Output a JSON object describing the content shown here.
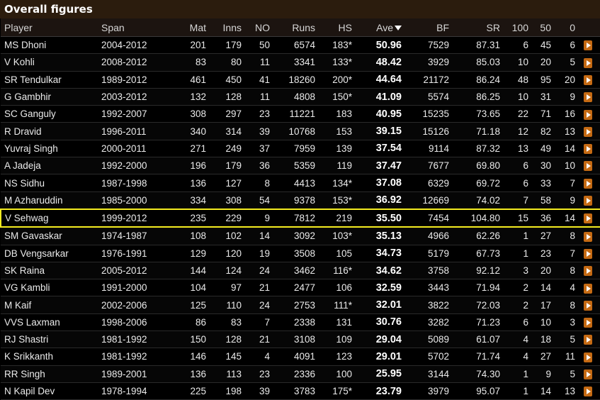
{
  "title": "Overall figures",
  "columns": {
    "player": "Player",
    "span": "Span",
    "mat": "Mat",
    "inns": "Inns",
    "no": "NO",
    "runs": "Runs",
    "hs": "HS",
    "ave": "Ave",
    "bf": "BF",
    "sr": "SR",
    "hundreds": "100",
    "fifties": "50",
    "ducks": "0"
  },
  "rows": [
    [
      "MS Dhoni",
      "2004-2012",
      "201",
      "179",
      "50",
      "6574",
      "183*",
      "50.96",
      "7529",
      "87.31",
      "6",
      "45",
      "6"
    ],
    [
      "V Kohli",
      "2008-2012",
      "83",
      "80",
      "11",
      "3341",
      "133*",
      "48.42",
      "3929",
      "85.03",
      "10",
      "20",
      "5"
    ],
    [
      "SR Tendulkar",
      "1989-2012",
      "461",
      "450",
      "41",
      "18260",
      "200*",
      "44.64",
      "21172",
      "86.24",
      "48",
      "95",
      "20"
    ],
    [
      "G Gambhir",
      "2003-2012",
      "132",
      "128",
      "11",
      "4808",
      "150*",
      "41.09",
      "5574",
      "86.25",
      "10",
      "31",
      "9"
    ],
    [
      "SC Ganguly",
      "1992-2007",
      "308",
      "297",
      "23",
      "11221",
      "183",
      "40.95",
      "15235",
      "73.65",
      "22",
      "71",
      "16"
    ],
    [
      "R Dravid",
      "1996-2011",
      "340",
      "314",
      "39",
      "10768",
      "153",
      "39.15",
      "15126",
      "71.18",
      "12",
      "82",
      "13"
    ],
    [
      "Yuvraj Singh",
      "2000-2011",
      "271",
      "249",
      "37",
      "7959",
      "139",
      "37.54",
      "9114",
      "87.32",
      "13",
      "49",
      "14"
    ],
    [
      "A Jadeja",
      "1992-2000",
      "196",
      "179",
      "36",
      "5359",
      "119",
      "37.47",
      "7677",
      "69.80",
      "6",
      "30",
      "10"
    ],
    [
      "NS Sidhu",
      "1987-1998",
      "136",
      "127",
      "8",
      "4413",
      "134*",
      "37.08",
      "6329",
      "69.72",
      "6",
      "33",
      "7"
    ],
    [
      "M Azharuddin",
      "1985-2000",
      "334",
      "308",
      "54",
      "9378",
      "153*",
      "36.92",
      "12669",
      "74.02",
      "7",
      "58",
      "9"
    ],
    [
      "V Sehwag",
      "1999-2012",
      "235",
      "229",
      "9",
      "7812",
      "219",
      "35.50",
      "7454",
      "104.80",
      "15",
      "36",
      "14"
    ],
    [
      "SM Gavaskar",
      "1974-1987",
      "108",
      "102",
      "14",
      "3092",
      "103*",
      "35.13",
      "4966",
      "62.26",
      "1",
      "27",
      "8"
    ],
    [
      "DB Vengsarkar",
      "1976-1991",
      "129",
      "120",
      "19",
      "3508",
      "105",
      "34.73",
      "5179",
      "67.73",
      "1",
      "23",
      "7"
    ],
    [
      "SK Raina",
      "2005-2012",
      "144",
      "124",
      "24",
      "3462",
      "116*",
      "34.62",
      "3758",
      "92.12",
      "3",
      "20",
      "8"
    ],
    [
      "VG Kambli",
      "1991-2000",
      "104",
      "97",
      "21",
      "2477",
      "106",
      "32.59",
      "3443",
      "71.94",
      "2",
      "14",
      "4"
    ],
    [
      "M Kaif",
      "2002-2006",
      "125",
      "110",
      "24",
      "2753",
      "111*",
      "32.01",
      "3822",
      "72.03",
      "2",
      "17",
      "8"
    ],
    [
      "VVS Laxman",
      "1998-2006",
      "86",
      "83",
      "7",
      "2338",
      "131",
      "30.76",
      "3282",
      "71.23",
      "6",
      "10",
      "3"
    ],
    [
      "RJ Shastri",
      "1981-1992",
      "150",
      "128",
      "21",
      "3108",
      "109",
      "29.04",
      "5089",
      "61.07",
      "4",
      "18",
      "5"
    ],
    [
      "K Srikkanth",
      "1981-1992",
      "146",
      "145",
      "4",
      "4091",
      "123",
      "29.01",
      "5702",
      "71.74",
      "4",
      "27",
      "11"
    ],
    [
      "RR Singh",
      "1989-2001",
      "136",
      "113",
      "23",
      "2336",
      "100",
      "25.95",
      "3144",
      "74.30",
      "1",
      "9",
      "5"
    ],
    [
      "N Kapil Dev",
      "1978-1994",
      "225",
      "198",
      "39",
      "3783",
      "175*",
      "23.79",
      "3979",
      "95.07",
      "1",
      "14",
      "13"
    ]
  ],
  "highlighted_row": "V Sehwag",
  "colors": {
    "highlight": "#f4ec20",
    "accent": "#c56a13",
    "header_bg": "#2b1c0d"
  }
}
